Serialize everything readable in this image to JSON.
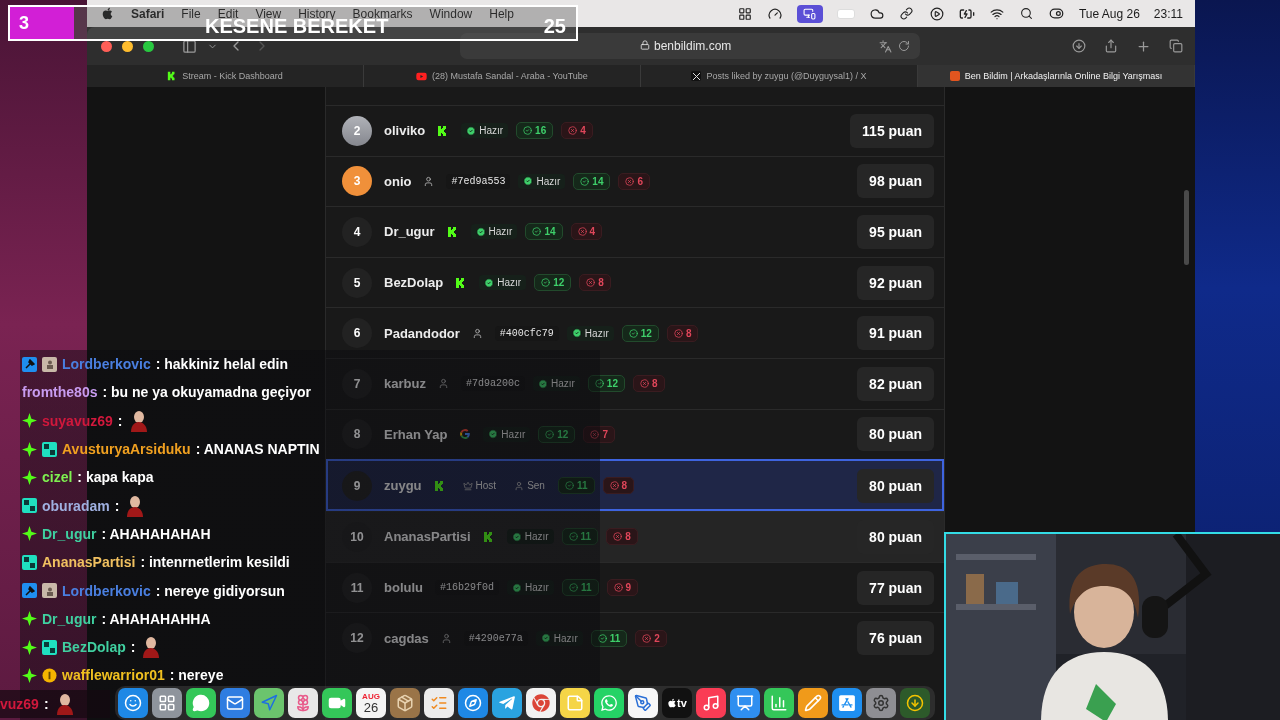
{
  "stream_banner": {
    "number": "3",
    "title": "KESENE BEREKET",
    "count": "25"
  },
  "menu_bar": {
    "app": "Safari",
    "menus": [
      "File",
      "Edit",
      "View",
      "History",
      "Bookmarks",
      "Window",
      "Help"
    ],
    "date": "Tue Aug 26",
    "time": "23:11"
  },
  "browser": {
    "address": "benbildim.com",
    "tabs": [
      {
        "title": "Stream - Kick Dashboard",
        "kind": "kick",
        "selected": false
      },
      {
        "title": "(28) Mustafa Sandal - Araba - YouTube",
        "kind": "youtube",
        "selected": false
      },
      {
        "title": "Posts liked by zuygu (@Duyguysal1) / X",
        "kind": "x",
        "selected": false
      },
      {
        "title": "Ben Bildim | Arkadaşlarınla Online Bilgi Yarışması",
        "kind": "site",
        "selected": true
      }
    ]
  },
  "leaderboard": {
    "rows": [
      {
        "rank": {
          "text": "2",
          "kind": "silver"
        },
        "name": "oliviko",
        "provider": {
          "kind": "kick"
        },
        "tags": [
          {
            "kind": "ready",
            "text": "Hazır"
          }
        ],
        "correct": "16",
        "wrong": "4",
        "score": "115 puan",
        "selected": false,
        "hovered": false
      },
      {
        "rank": {
          "text": "3",
          "kind": "bronze"
        },
        "name": "onio",
        "provider": {
          "kind": "guest"
        },
        "tags": [
          {
            "kind": "id",
            "text": "#7ed9a553"
          },
          {
            "kind": "ready",
            "text": "Hazır"
          }
        ],
        "correct": "14",
        "wrong": "6",
        "score": "98 puan",
        "selected": false,
        "hovered": false
      },
      {
        "rank": {
          "text": "4",
          "kind": "plain"
        },
        "name": "Dr_ugur",
        "provider": {
          "kind": "kick"
        },
        "tags": [
          {
            "kind": "ready",
            "text": "Hazır"
          }
        ],
        "correct": "14",
        "wrong": "4",
        "score": "95 puan",
        "selected": false,
        "hovered": false
      },
      {
        "rank": {
          "text": "5",
          "kind": "plain"
        },
        "name": "BezDolap",
        "provider": {
          "kind": "kick"
        },
        "tags": [
          {
            "kind": "ready",
            "text": "Hazır"
          }
        ],
        "correct": "12",
        "wrong": "8",
        "score": "92 puan",
        "selected": false,
        "hovered": false
      },
      {
        "rank": {
          "text": "6",
          "kind": "plain"
        },
        "name": "Padandodor",
        "provider": {
          "kind": "guest"
        },
        "tags": [
          {
            "kind": "id",
            "text": "#400cfc79"
          },
          {
            "kind": "ready",
            "text": "Hazır"
          }
        ],
        "correct": "12",
        "wrong": "8",
        "score": "91 puan",
        "selected": false,
        "hovered": false
      },
      {
        "rank": {
          "text": "7",
          "kind": "plain"
        },
        "name": "karbuz",
        "provider": {
          "kind": "guest"
        },
        "tags": [
          {
            "kind": "id",
            "text": "#7d9a200c"
          },
          {
            "kind": "ready",
            "text": "Hazır"
          }
        ],
        "correct": "12",
        "wrong": "8",
        "score": "82 puan",
        "selected": false,
        "hovered": false
      },
      {
        "rank": {
          "text": "8",
          "kind": "plain"
        },
        "name": "Erhan Yap",
        "provider": {
          "kind": "google"
        },
        "tags": [
          {
            "kind": "ready",
            "text": "Hazır"
          }
        ],
        "correct": "12",
        "wrong": "7",
        "score": "80 puan",
        "selected": false,
        "hovered": false
      },
      {
        "rank": {
          "text": "9",
          "kind": "plain"
        },
        "name": "zuygu",
        "provider": {
          "kind": "kick"
        },
        "tags": [
          {
            "kind": "host",
            "text": "Host"
          },
          {
            "kind": "you",
            "text": "Sen"
          }
        ],
        "correct": "11",
        "wrong": "8",
        "score": "80 puan",
        "selected": true,
        "hovered": false
      },
      {
        "rank": {
          "text": "10",
          "kind": "plain"
        },
        "name": "AnanasPartisi",
        "provider": {
          "kind": "kick"
        },
        "tags": [
          {
            "kind": "ready",
            "text": "Hazır"
          }
        ],
        "correct": "11",
        "wrong": "8",
        "score": "80 puan",
        "selected": false,
        "hovered": true
      },
      {
        "rank": {
          "text": "11",
          "kind": "plain"
        },
        "name": "bolulu",
        "tags": [
          {
            "kind": "id",
            "text": "#16b29f0d"
          },
          {
            "kind": "ready",
            "text": "Hazır"
          }
        ],
        "correct": "11",
        "wrong": "9",
        "score": "77 puan",
        "selected": false,
        "hovered": false
      },
      {
        "rank": {
          "text": "12",
          "kind": "plain"
        },
        "name": "cagdas",
        "provider": {
          "kind": "guest"
        },
        "tags": [
          {
            "kind": "id",
            "text": "#4290e77a"
          },
          {
            "kind": "ready",
            "text": "Hazır"
          }
        ],
        "correct": "11",
        "wrong": "2",
        "score": "76 puan",
        "selected": false,
        "hovered": false
      }
    ]
  },
  "chat": {
    "messages": [
      {
        "badges": [
          {
            "kind": "mod"
          },
          {
            "kind": "avatar"
          }
        ],
        "user": "Lordberkovic",
        "color": "#4a7fe0",
        "text": ": hakkiniz helal edin",
        "emote": false,
        "cut": false
      },
      {
        "user": "fromthe80s",
        "color": "#c89cf0",
        "text": ": bu ne ya okuyamadna geçiyor",
        "emote": false,
        "cut": false
      },
      {
        "badges": [
          {
            "kind": "sub"
          }
        ],
        "user": "suyavuz69",
        "color": "#d0183c",
        "text": ":",
        "emote": true,
        "cut": false
      },
      {
        "badges": [
          {
            "kind": "sub"
          },
          {
            "kind": "og"
          }
        ],
        "user": "AvusturyaArsiduku",
        "color": "#f0a020",
        "text": ": ANANAS NAPTIN",
        "emote": false,
        "cut": false
      },
      {
        "badges": [
          {
            "kind": "sub"
          }
        ],
        "user": "cizel",
        "color": "#7ef050",
        "text": ": kapa kapa",
        "emote": false,
        "cut": false
      },
      {
        "badges": [
          {
            "kind": "og"
          }
        ],
        "user": "oburadam",
        "color": "#9fb0e0",
        "text": ":",
        "emote": true,
        "cut": false
      },
      {
        "badges": [
          {
            "kind": "sub"
          }
        ],
        "user": "Dr_ugur",
        "color": "#3fd0a0",
        "text": ": AHAHAHAHAH",
        "emote": false,
        "cut": false
      },
      {
        "badges": [
          {
            "kind": "og"
          }
        ],
        "user": "AnanasPartisi",
        "color": "#f0c060",
        "text": ": intenrnetlerim kesildi",
        "emote": false,
        "cut": false
      },
      {
        "badges": [
          {
            "kind": "mod"
          },
          {
            "kind": "avatar"
          }
        ],
        "user": "Lordberkovic",
        "color": "#4a7fe0",
        "text": ": nereye gidiyorsun",
        "emote": false,
        "cut": false
      },
      {
        "badges": [
          {
            "kind": "sub"
          }
        ],
        "user": "Dr_ugur",
        "color": "#3fd0a0",
        "text": ": AHAHAHAHHA",
        "emote": false,
        "cut": false
      },
      {
        "badges": [
          {
            "kind": "sub"
          },
          {
            "kind": "og"
          }
        ],
        "user": "BezDolap",
        "color": "#40d0a0",
        "text": ":",
        "emote": true,
        "cut": false
      },
      {
        "badges": [
          {
            "kind": "sub"
          },
          {
            "kind": "gift"
          }
        ],
        "user": "wafflewarrior01",
        "color": "#f0c020",
        "text": ": nereye",
        "emote": false,
        "cut": false
      },
      {
        "user": "vuz69",
        "color": "#d0183c",
        "text": ":",
        "emote": true,
        "cut": true
      }
    ]
  },
  "dock": {
    "apps": [
      {
        "kind": "finder",
        "color": "#1e88e5"
      },
      {
        "kind": "grid",
        "color": "#8e949c"
      },
      {
        "kind": "bubble",
        "color": "#34c759"
      },
      {
        "kind": "mail",
        "color": "#2f7de1"
      },
      {
        "kind": "map",
        "color": "#6bc46d"
      },
      {
        "kind": "flower",
        "color": "#e8e8e8"
      },
      {
        "kind": "camera",
        "color": "#34c759"
      },
      {
        "kind": "calendar",
        "color": "#f4f4f4",
        "month": "AUG",
        "day": "26"
      },
      {
        "kind": "box",
        "color": "#9a7448"
      },
      {
        "kind": "list",
        "color": "#ececec"
      },
      {
        "kind": "compass",
        "color": "#1e88e5"
      },
      {
        "kind": "plane",
        "color": "#2aa3e0"
      },
      {
        "kind": "chrome",
        "color": "#f2f2f2"
      },
      {
        "kind": "notepad",
        "color": "#f5d547"
      },
      {
        "kind": "whatsapp",
        "color": "#25d366"
      },
      {
        "kind": "pen",
        "color": "#f7f7f7"
      },
      {
        "kind": "tv",
        "color": "#111111",
        "label": "tv"
      },
      {
        "kind": "music",
        "color": "#fa3c55"
      },
      {
        "kind": "podium",
        "color": "#2f8ff0"
      },
      {
        "kind": "chart",
        "color": "#34c759"
      },
      {
        "kind": "pencil",
        "color": "#f09a1a"
      },
      {
        "kind": "appstore",
        "color": "#1e8ff0"
      },
      {
        "kind": "gear",
        "color": "#8e8e93"
      },
      {
        "kind": "download",
        "color": "#2d5a2a"
      }
    ]
  }
}
